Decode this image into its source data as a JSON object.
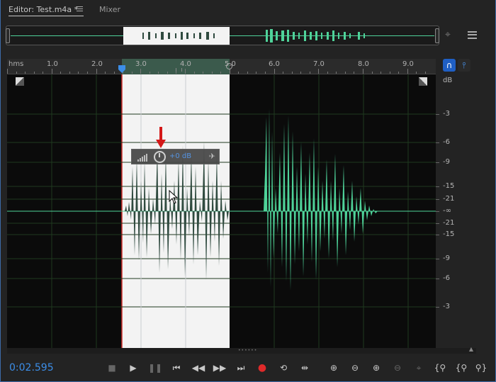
{
  "tabs": {
    "editor": "Editor: Test.m4a *",
    "mixer": "Mixer"
  },
  "ruler": {
    "unit": "hms",
    "labels": [
      "1.0",
      "2.0",
      "3.0",
      "4.0",
      "5.0",
      "6.0",
      "7.0",
      "8.0",
      "9.0"
    ]
  },
  "db_scale": {
    "unit": "dB",
    "labels": [
      "-3",
      "-6",
      "-9",
      "-15",
      "-21",
      "-∞",
      "-21",
      "-15",
      "-9",
      "-6",
      "-3"
    ]
  },
  "hud": {
    "value": "+0 dB"
  },
  "transport": {
    "time": "0:02.595"
  },
  "icons": {
    "tab_menu": "hamburger-icon",
    "overview_zoom": "zoom-target-icon",
    "overview_menu": "list-icon",
    "snap": "magnet-icon",
    "pin": "pin-icon",
    "hud_pin": "pin-icon"
  },
  "colors": {
    "waveform": "#4fd39a",
    "waveform_selected": "#2f4a3f",
    "selection_bg": "#f3f3f3",
    "accent_blue": "#3c8ee8",
    "record_red": "#e02a2a"
  }
}
